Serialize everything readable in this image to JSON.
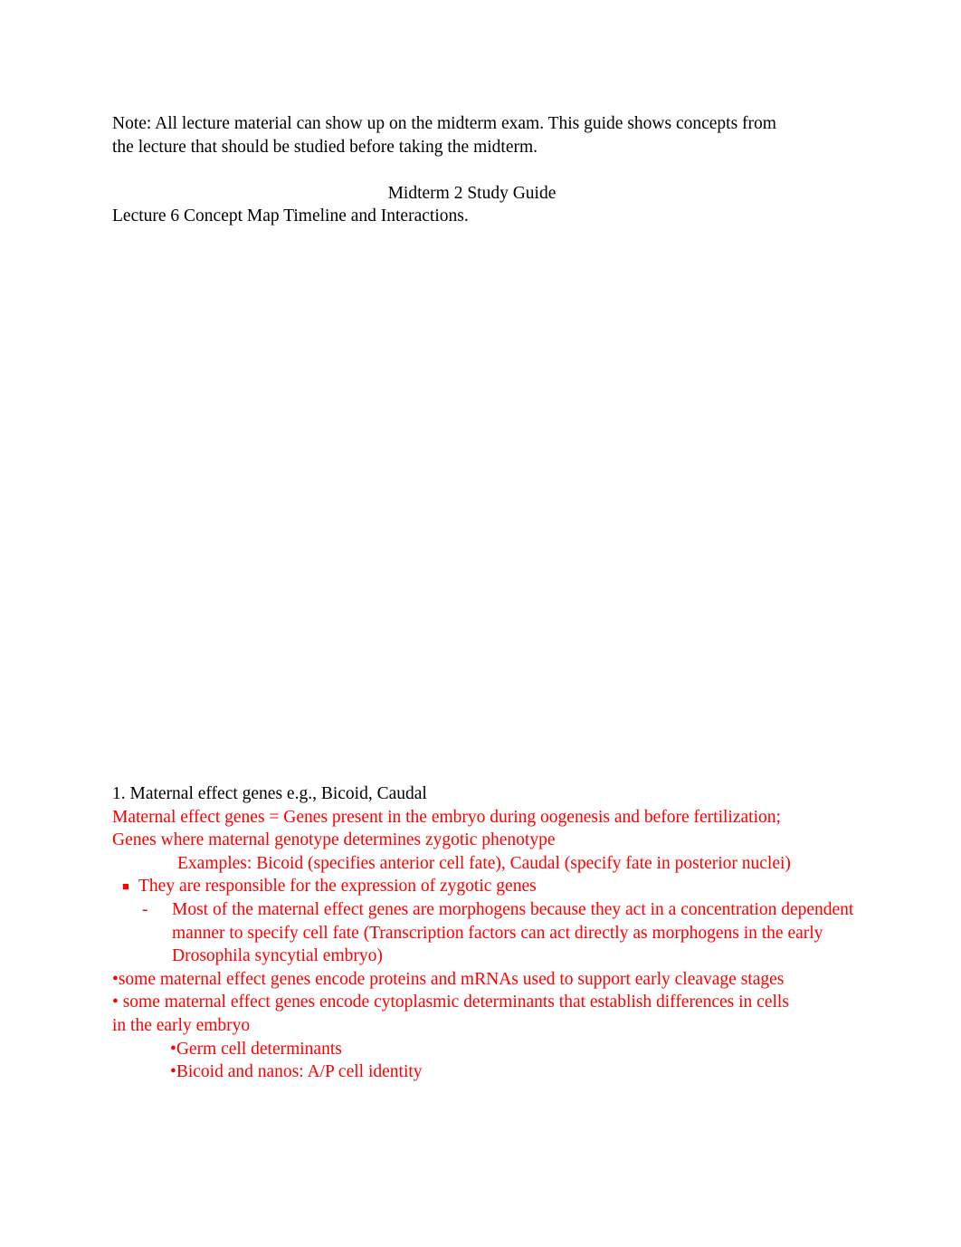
{
  "document": {
    "intro_note": "Note: All lecture material can show up on the midterm exam. This guide shows concepts from the lecture that should be studied before taking the midterm.",
    "title": "Midterm 2 Study Guide",
    "lecture_line": "Lecture 6 Concept Map Timeline and Interactions.",
    "section": {
      "heading": "1. Maternal effect genes e.g., Bicoid, Caudal",
      "definition_line_1": "Maternal effect genes = Genes present in the embryo during oogenesis and before fertilization;",
      "definition_line_2": "Genes where maternal genotype determines zygotic phenotype",
      "examples_line": "Examples:   Bicoid (specifies anterior cell fate), Caudal (specify fate in posterior nuclei)",
      "square_bullet": {
        "marker": "■",
        "text": "They are responsible for the expression of zygotic genes"
      },
      "dash_bullet": {
        "marker": "-",
        "text": "Most of the maternal effect genes are morphogens because they act in a concentration dependent manner to specify cell fate (Transcription factors can act directly as morphogens in the early Drosophila syncytial embryo)"
      },
      "dot_bullets": [
        {
          "marker": "•",
          "text": "some maternal effect genes encode proteins and mRNAs used to support early cleavage stages"
        },
        {
          "marker": "•",
          "text": " some maternal effect genes encode cytoplasmic determinants that establish differences in cells in the early embryo"
        }
      ],
      "sub_dot_bullets": [
        {
          "marker": "•",
          "text": "Germ cell determinants"
        },
        {
          "marker": "•",
          "text": "Bicoid and nanos: A/P cell identity"
        }
      ]
    }
  },
  "colors": {
    "body_text": "#000000",
    "highlight_text": "#ff0000",
    "page_background": "#ffffff"
  }
}
